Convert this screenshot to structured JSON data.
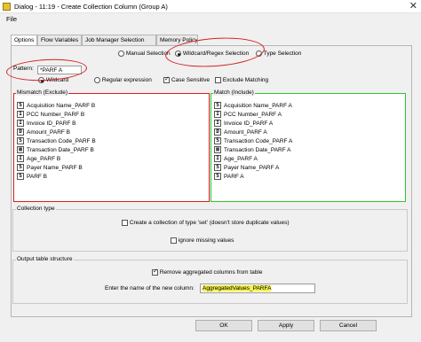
{
  "window": {
    "title": "Dialog - 11:19 - Create Collection Column (Group A)",
    "close": "✕"
  },
  "menu": {
    "file": "File"
  },
  "tabs": [
    "Options",
    "Flow Variables",
    "Job Manager Selection",
    "Memory Policy"
  ],
  "selection_mode": {
    "options": [
      "Manual Selection",
      "Wildcard/Regex Selection",
      "Type Selection"
    ],
    "selected": "Wildcard/Regex Selection"
  },
  "pattern": {
    "label": "Pattern:",
    "value": "*PARF A"
  },
  "pattern_options": {
    "wildcard": "Wildcard",
    "regex": "Regular expression",
    "case_sensitive": "Case Sensitive",
    "exclude_matching": "Exclude Matching"
  },
  "mismatch": {
    "title": "Mismatch (Exclude)",
    "items": [
      {
        "type": "S",
        "name": "Acquisition Name_PARF B"
      },
      {
        "type": "I",
        "name": "PCC Number_PARF B"
      },
      {
        "type": "I",
        "name": "Invoice ID_PARF B"
      },
      {
        "type": "D",
        "name": "Amount_PARF B"
      },
      {
        "type": "S",
        "name": "Transaction Code_PARF B"
      },
      {
        "type": "▦",
        "name": "Transaction Date_PARF B"
      },
      {
        "type": "I",
        "name": "Age_PARF B"
      },
      {
        "type": "S",
        "name": "Payer Name_PARF B"
      },
      {
        "type": "S",
        "name": "PARF B"
      }
    ]
  },
  "match": {
    "title": "Match (Include)",
    "items": [
      {
        "type": "S",
        "name": "Acquisition Name_PARF A"
      },
      {
        "type": "I",
        "name": "PCC Number_PARF A"
      },
      {
        "type": "I",
        "name": "Invoice ID_PARF A"
      },
      {
        "type": "D",
        "name": "Amount_PARF A"
      },
      {
        "type": "S",
        "name": "Transaction Code_PARF A"
      },
      {
        "type": "▦",
        "name": "Transaction Date_PARF A"
      },
      {
        "type": "I",
        "name": "Age_PARF A"
      },
      {
        "type": "S",
        "name": "Payer Name_PARF A"
      },
      {
        "type": "S",
        "name": "PARF A"
      }
    ]
  },
  "collection_type": {
    "title": "Collection type",
    "create_set": "Create a collection of type 'set' (doesn't store duplicate values)",
    "ignore_missing": "ignore missing values"
  },
  "output": {
    "title": "Output table structure",
    "remove_aggregated": "Remove aggregated columns from table",
    "name_label": "Enter the name of the new column:",
    "name_value": "AggregatedValues_PARFA"
  },
  "buttons": {
    "ok": "OK",
    "apply": "Apply",
    "cancel": "Cancel"
  },
  "colors": {
    "annotation_red": "#d42020",
    "mismatch_border": "#d42020",
    "match_border": "#2ec82e",
    "highlight": "#f4f24a"
  }
}
